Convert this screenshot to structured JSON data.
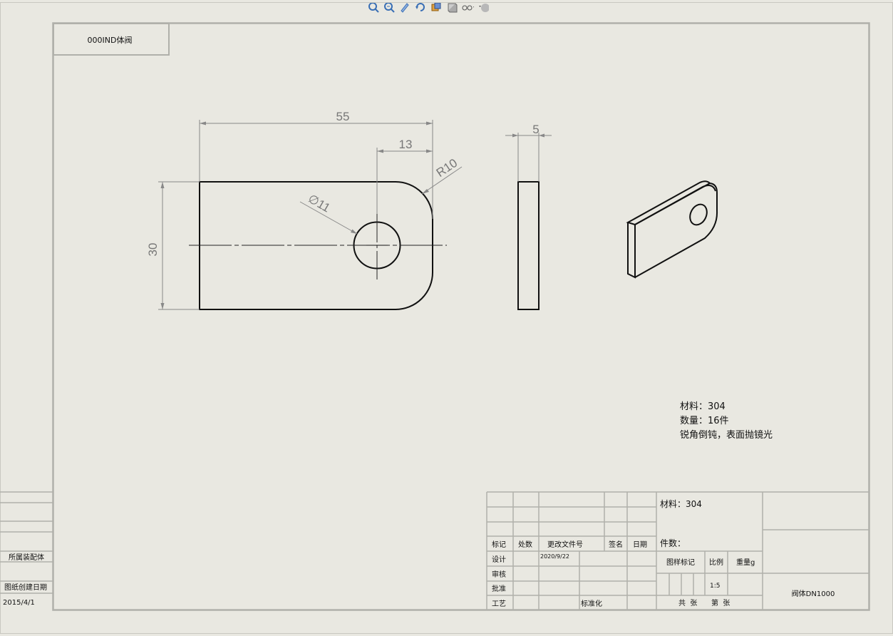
{
  "toolbar": {
    "icons": [
      "zoom-to-fit-icon",
      "zoom-area-icon",
      "pan-icon",
      "rotate-icon",
      "view-orientation-icon",
      "display-style-icon",
      "hide-show-icon",
      "appearance-icon"
    ]
  },
  "title_tab": {
    "text": "000IND体阀"
  },
  "dimensions": {
    "length": "55",
    "hole_offset": "13",
    "radius": "R10",
    "hole_dia": "∅11",
    "height": "30",
    "thickness": "5"
  },
  "notes": {
    "line1": "材料：304",
    "line2": "数量：16件",
    "line3": "锐角倒钝，表面抛镜光"
  },
  "left_block": {
    "assembly_label": "所属装配体",
    "created_label": "图纸创建日期",
    "created_value": "2015/4/1"
  },
  "title_block": {
    "headers": {
      "mark": "标记",
      "zones": "处数",
      "change_doc": "更改文件号",
      "signature": "签名",
      "date": "日期"
    },
    "rows": {
      "design": "设计",
      "review": "审核",
      "approve": "批准",
      "process": "工艺",
      "standardize": "标准化"
    },
    "design_date": "2020/9/22",
    "material": "材料：304",
    "quantity_label": "件数：",
    "drawing_mark": "图样标记",
    "scale_label": "比例",
    "weight_label": "重量g",
    "scale_value": "1:5",
    "total_sheets": "共  张",
    "sheet_no": "第  张",
    "part_name": "阀体DN1000"
  }
}
